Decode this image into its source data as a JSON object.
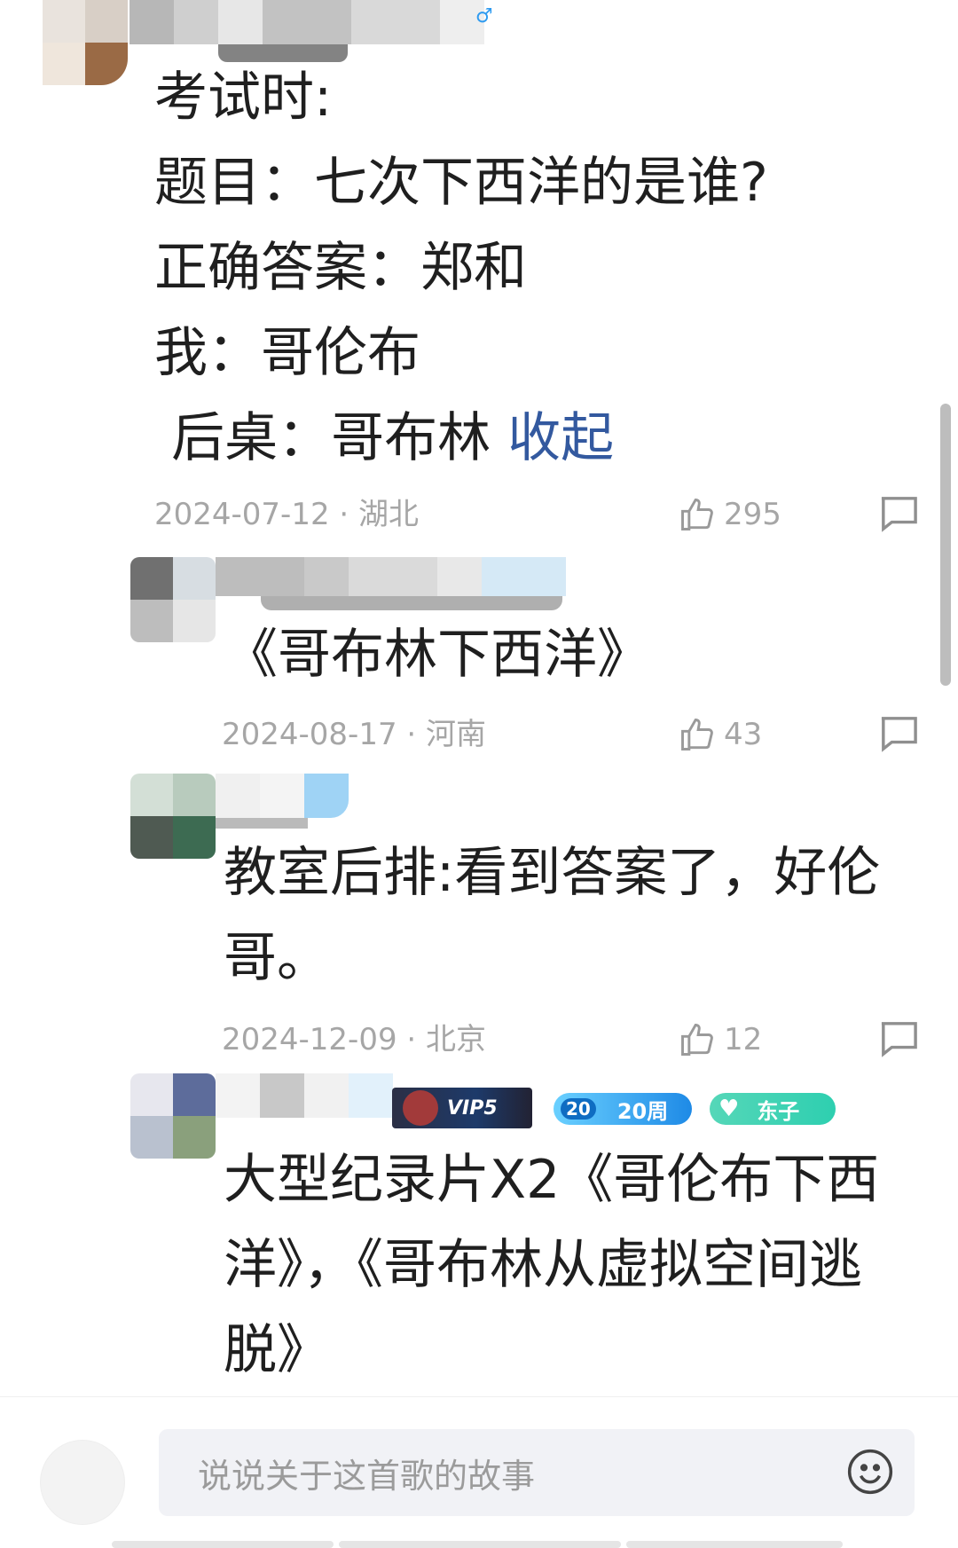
{
  "comments": [
    {
      "text": "考试时:\n题目：七次下西洋的是谁?\n正确答案：郑和\n我：哥伦布\n 后桌：哥布林 ",
      "collapse_label": "收起",
      "date": "2024-07-12 · 湖北",
      "likes": "295"
    },
    {
      "text": "《哥布林下西洋》",
      "date": "2024-08-17 · 河南",
      "likes": "43"
    },
    {
      "text": "教室后排:看到答案了，好伦哥。",
      "date": "2024-12-09 · 北京",
      "likes": "12"
    },
    {
      "text": "大型纪录片X2《哥伦布下西洋》，《哥布林从虚拟空间逃脱》",
      "badges": {
        "vip": "VIP5",
        "weeks_icon": "20",
        "weeks": "20周",
        "tag": "东子"
      }
    }
  ],
  "composer": {
    "placeholder": "说说关于这首歌的故事",
    "emoji_icon": "smile-emoji-icon"
  },
  "icons": {
    "like": "thumbs-up-icon",
    "reply": "comment-bubble-icon",
    "gender": "male-icon"
  },
  "colors": {
    "accent_link": "#33599f",
    "meta_gray": "#a6a6a6",
    "male_blue": "#2f9bf0",
    "weeks_badge": "#1e8ae6",
    "tag_badge": "#2ecfb0"
  }
}
